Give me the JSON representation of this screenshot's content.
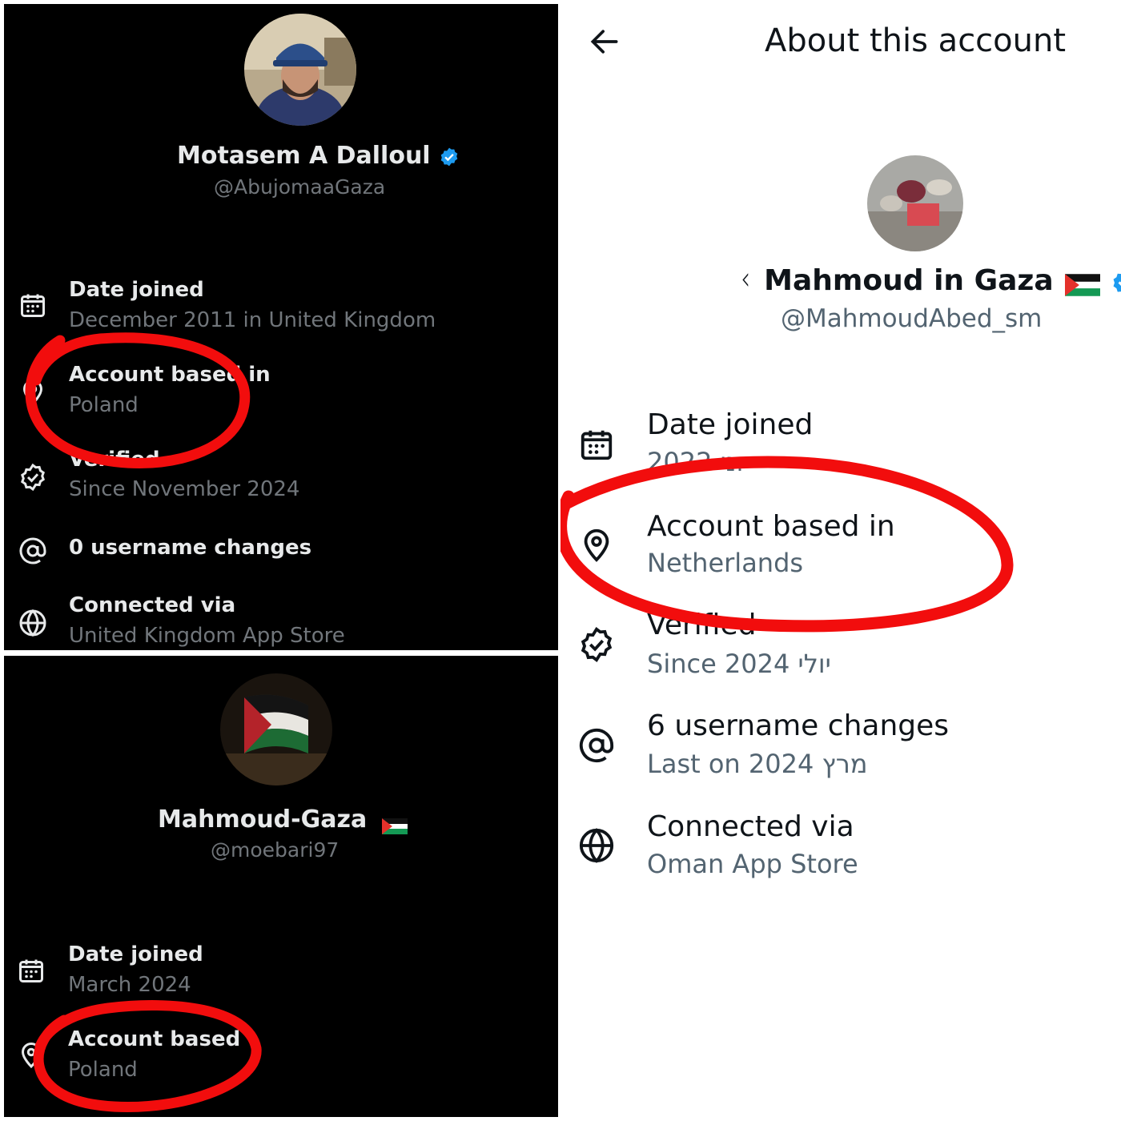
{
  "panel_top_left": {
    "profile_name": "Motasem A Dalloul",
    "profile_handle": "@AbujomaaGaza",
    "rows": [
      {
        "icon": "calendar-icon",
        "title": "Date joined",
        "sub": "December 2011 in United Kingdom"
      },
      {
        "icon": "location-icon",
        "title": "Account based in",
        "sub": "Poland"
      },
      {
        "icon": "verified-icon",
        "title": "Verified",
        "sub": "Since November 2024"
      },
      {
        "icon": "at-icon",
        "title": "0 username changes",
        "sub": ""
      },
      {
        "icon": "globe-icon",
        "title": "Connected via",
        "sub": "United Kingdom App Store"
      }
    ]
  },
  "panel_bottom_left": {
    "profile_name": "Mahmoud-Gaza",
    "profile_flag": "palestine-flag",
    "profile_handle": "@moebari97",
    "rows": [
      {
        "icon": "calendar-icon",
        "title": "Date joined",
        "sub": "March 2024"
      },
      {
        "icon": "location-icon",
        "title": "Account based",
        "sub": "Poland"
      }
    ]
  },
  "panel_right": {
    "page_title": "About this account",
    "back_icon": "arrow-left-icon",
    "profile_prefix": "ᚲ",
    "profile_name": "Mahmoud in Gaza",
    "profile_flag": "palestine-flag",
    "profile_handle": "@MahmoudAbed_sm",
    "rows": [
      {
        "icon": "calendar-icon",
        "title": "Date joined",
        "sub": "2022 יוני"
      },
      {
        "icon": "location-icon",
        "title": "Account based in",
        "sub": "Netherlands"
      },
      {
        "icon": "verified-icon",
        "title": "Verified",
        "sub": "Since 2024 יולי"
      },
      {
        "icon": "at-icon",
        "title": "6 username changes",
        "sub": "Last on 2024 מרץ"
      },
      {
        "icon": "globe-icon",
        "title": "Connected via",
        "sub": "Oman App Store"
      }
    ]
  },
  "colors": {
    "verified_blue": "#1d9bf0",
    "annotation_red": "#f20d0d",
    "dark_bg": "#000000",
    "dark_secondary": "#71767b",
    "light_secondary": "#536471"
  }
}
